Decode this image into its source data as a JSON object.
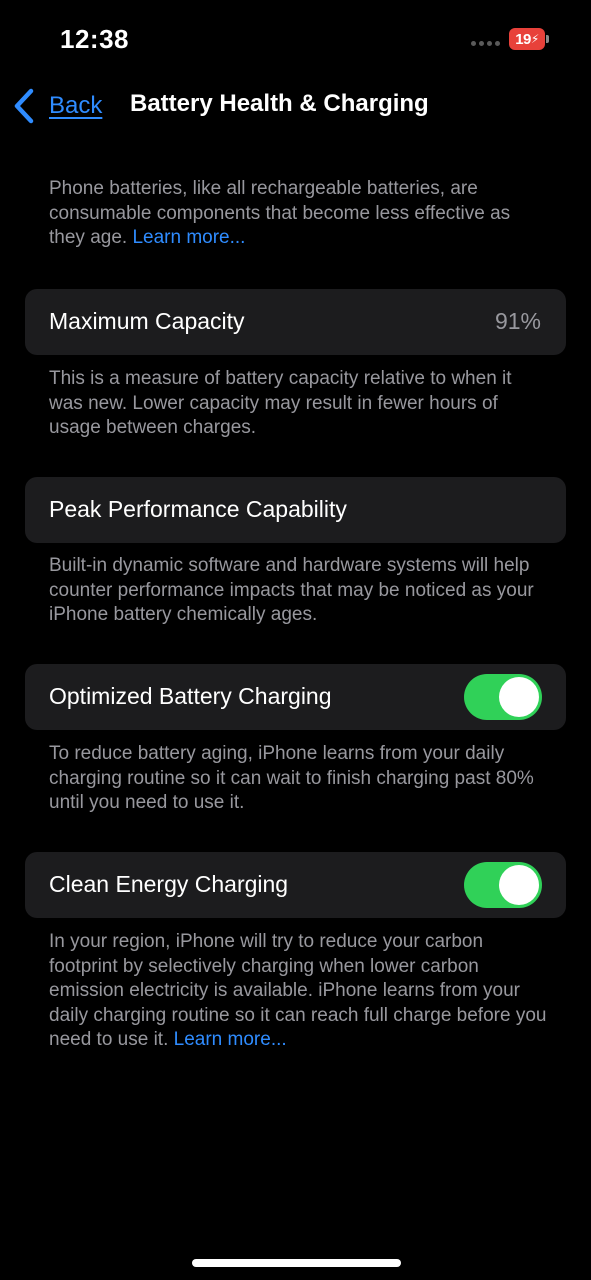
{
  "status_bar": {
    "time": "12:38",
    "battery_level": "19",
    "battery_charging_glyph": "⚡",
    "battery_color": "#e8413a",
    "signal_icon": "signal-dots-icon"
  },
  "nav": {
    "back_label": "Back",
    "title": "Battery Health & Charging",
    "accent_color": "#2f8cff"
  },
  "intro": {
    "text": "Phone batteries, like all rechargeable batteries, are consumable components that become less effective as they age.",
    "link": "Learn more..."
  },
  "maximum_capacity": {
    "label": "Maximum Capacity",
    "value": "91%",
    "description": "This is a measure of battery capacity relative to when it was new. Lower capacity may result in fewer hours of usage between charges."
  },
  "peak_performance": {
    "label": "Peak Performance Capability",
    "description": "Built-in dynamic software and hardware systems will help counter performance impacts that may be noticed as your iPhone battery chemically ages."
  },
  "optimized_charging": {
    "label": "Optimized Battery Charging",
    "enabled": true,
    "description": "To reduce battery aging, iPhone learns from your daily charging routine so it can wait to finish charging past 80% until you need to use it."
  },
  "clean_energy": {
    "label": "Clean Energy Charging",
    "enabled": true,
    "description": "In your region, iPhone will try to reduce your carbon footprint by selectively charging when lower carbon emission electricity is available. iPhone learns from your daily charging routine so it can reach full charge before you need to use it.",
    "link": "Learn more..."
  },
  "toggle_on_color": "#30d158"
}
